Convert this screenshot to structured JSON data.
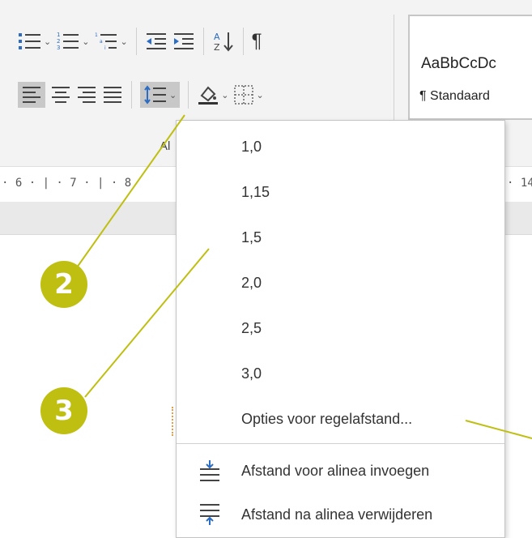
{
  "ribbon": {
    "group_label": "Al",
    "styles": {
      "sample": "AaBbCcDc",
      "name": "¶ Standaard"
    }
  },
  "ruler": {
    "left_text": "· 6 · | · 7 · | · 8",
    "right_text": "· 14"
  },
  "menu": {
    "spacing_options": [
      "1,0",
      "1,15",
      "1,5",
      "2,0",
      "2,5",
      "3,0"
    ],
    "options_label": "Opties voor regelafstand...",
    "add_before_label": "Afstand voor alinea invoegen",
    "remove_after_label": "Afstand na alinea verwijderen"
  },
  "callouts": {
    "two": "2",
    "three": "3"
  },
  "colors": {
    "callout": "#bfbf12",
    "ribbon": "#f3f3f3"
  },
  "icons": [
    "bullets-icon",
    "numbering-icon",
    "multilevel-list-icon",
    "decrease-indent-icon",
    "increase-indent-icon",
    "sort-icon",
    "pilcrow-icon",
    "align-left-icon",
    "align-center-icon",
    "align-right-icon",
    "justify-icon",
    "line-spacing-icon",
    "shading-icon",
    "borders-icon"
  ]
}
